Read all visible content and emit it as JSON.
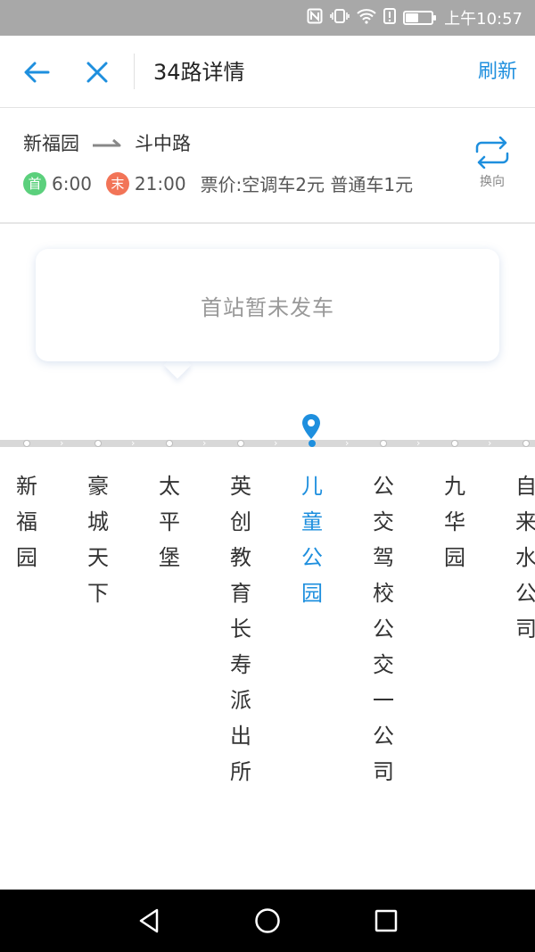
{
  "status_bar": {
    "time": "上午10:57",
    "battery_level": 0.5,
    "icons": [
      "nfc-icon",
      "vibrate-icon",
      "wifi-icon",
      "alert-icon",
      "battery-icon"
    ]
  },
  "nav": {
    "title": "34路详情",
    "refresh_label": "刷新",
    "back_icon": "back-arrow-icon",
    "close_icon": "close-icon"
  },
  "route": {
    "from": "新福园",
    "to": "斗中路",
    "first_badge": "首",
    "first_time": "6:00",
    "last_badge": "末",
    "last_time": "21:00",
    "fare": "票价:空调车2元 普通车1元",
    "swap_label": "换向"
  },
  "bus_status": {
    "message": "首站暂未发车"
  },
  "stops": [
    {
      "name": "新福园",
      "current": false
    },
    {
      "name": "豪城天下",
      "current": false
    },
    {
      "name": "太平堡",
      "current": false
    },
    {
      "name": "英创教育长寿派出所",
      "current": false
    },
    {
      "name": "儿童公园",
      "current": true
    },
    {
      "name": "公交驾校公交一公司",
      "current": false
    },
    {
      "name": "九华园",
      "current": false
    },
    {
      "name": "自来水公司",
      "current": false
    }
  ],
  "colors": {
    "accent": "#1e8fde",
    "first_badge": "#5bd07c",
    "last_badge": "#f27457",
    "status_bar": "#a8a8a8"
  }
}
